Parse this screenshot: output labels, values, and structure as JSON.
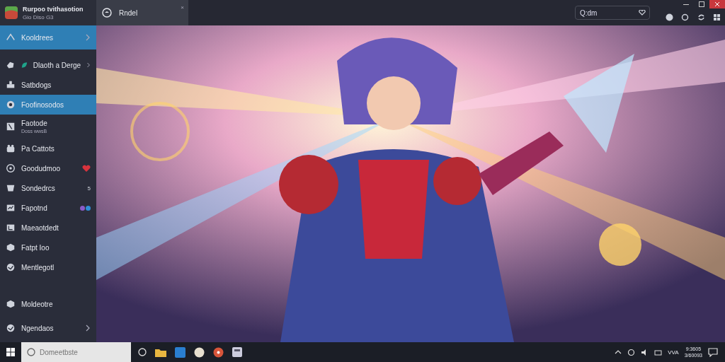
{
  "app": {
    "title": "Rurpoo tvithasotion",
    "subtitle": "Gio  Diso  G3"
  },
  "sidebar": {
    "items": [
      {
        "label": "Kooldrees",
        "selected": true,
        "expandable": true,
        "kind": "plain"
      },
      {
        "label": "Dlaoth a Derge",
        "selected": false,
        "expandable": true,
        "kind": "badge"
      },
      {
        "label": "Satbdogs",
        "selected": false,
        "expandable": false,
        "kind": "plain"
      },
      {
        "label": "Foofinosodos",
        "selected": true,
        "expandable": false,
        "kind": "plain"
      },
      {
        "label": "Faotode",
        "selected": false,
        "expandable": false,
        "kind": "sub",
        "subtitle": "Doss wwsB"
      },
      {
        "label": "Pa Cattots",
        "selected": false,
        "expandable": false,
        "kind": "plain"
      },
      {
        "label": "Goodudmoo",
        "selected": false,
        "expandable": false,
        "kind": "heart"
      },
      {
        "label": "Sondedrcs",
        "selected": false,
        "expandable": false,
        "kind": "count",
        "count": "5"
      },
      {
        "label": "Fapotnd",
        "selected": false,
        "expandable": false,
        "kind": "dots",
        "dots": [
          {
            "color": "#8a5cc8"
          },
          {
            "color": "#2f8fd8"
          }
        ]
      },
      {
        "label": "Maeaotdedt",
        "selected": false,
        "expandable": false,
        "kind": "plain"
      },
      {
        "label": "Fatpt Ioo",
        "selected": false,
        "expandable": false,
        "kind": "plain"
      },
      {
        "label": "Mentlegotl",
        "selected": false,
        "expandable": false,
        "kind": "plain"
      }
    ],
    "footer": [
      {
        "label": "Moldeotre",
        "expandable": false
      },
      {
        "label": "Ngendaos",
        "expandable": true
      }
    ]
  },
  "tab": {
    "title": "Rndel",
    "close": "×"
  },
  "search": {
    "value": "Q:dm"
  },
  "taskbar": {
    "search_placeholder": "Domeetbste",
    "tray_text": "VVA",
    "time": "9:3605",
    "date": "3/60093"
  }
}
